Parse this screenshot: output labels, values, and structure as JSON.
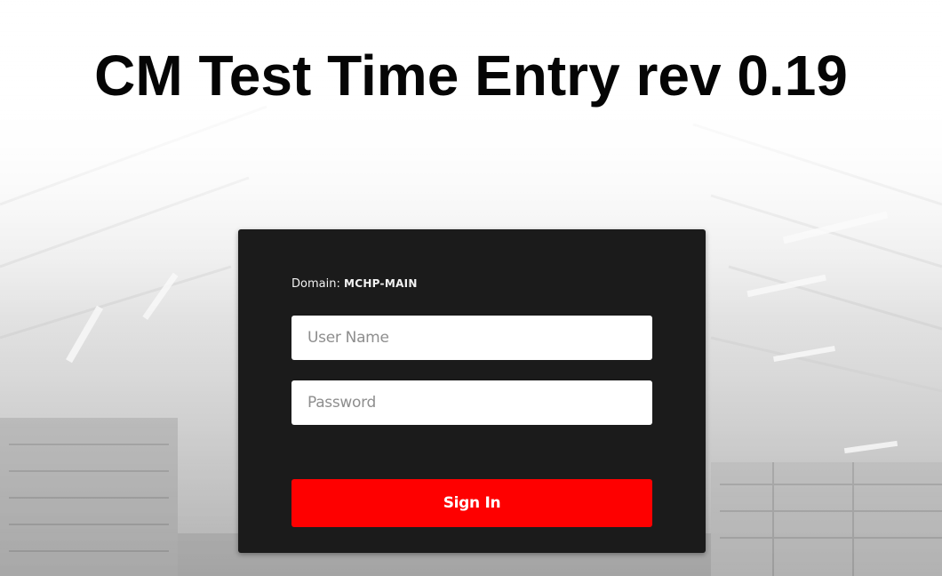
{
  "header": {
    "title": "CM Test Time Entry rev 0.19"
  },
  "login": {
    "domain_label": "Domain: ",
    "domain_value": "MCHP-MAIN",
    "username": {
      "value": "",
      "placeholder": "User Name"
    },
    "password": {
      "value": "",
      "placeholder": "Password"
    },
    "signin_label": "Sign In"
  },
  "colors": {
    "panel_bg": "#1b1b1b",
    "button_bg": "#fe0000",
    "title_text": "#050505"
  }
}
